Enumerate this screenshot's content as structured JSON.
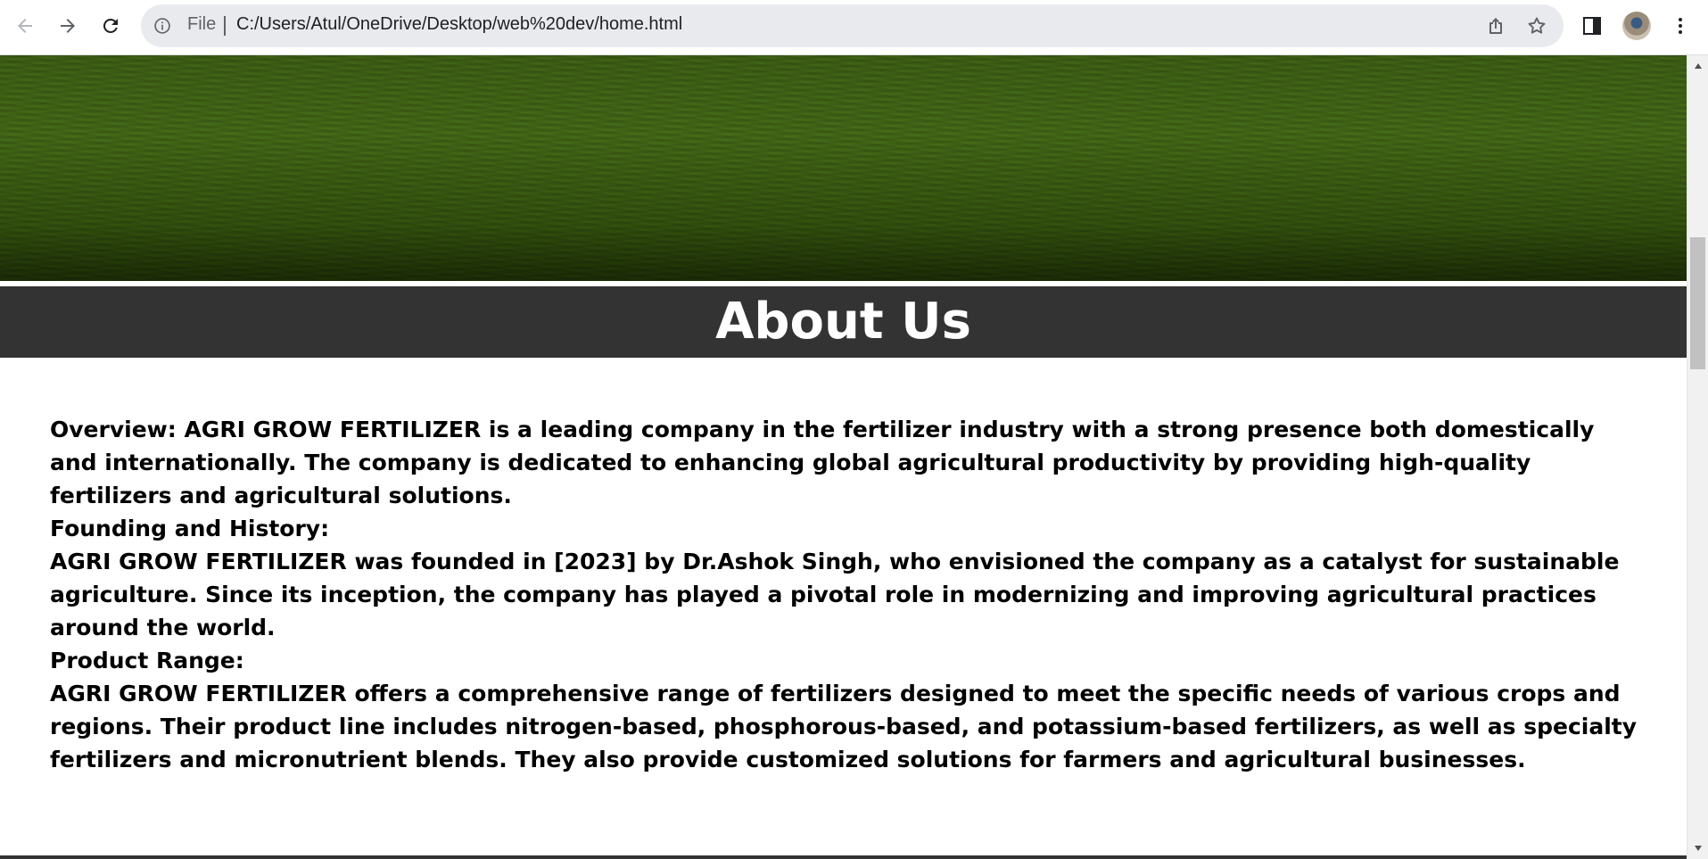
{
  "browser": {
    "back_icon": "arrow-left-icon",
    "forward_icon": "arrow-right-icon",
    "reload_icon": "reload-icon",
    "site_info_icon": "info-icon",
    "scheme_label": "File",
    "url": "C:/Users/Atul/OneDrive/Desktop/web%20dev/home.html",
    "share_icon": "share-icon",
    "bookmark_icon": "star-icon",
    "side_panel_icon": "side-panel-icon",
    "menu_icon": "kebab-menu-icon"
  },
  "page": {
    "about": {
      "title": "About Us",
      "paragraphs": [
        "Overview: AGRI GROW FERTILIZER is a leading company in the fertilizer industry with a strong presence both domestically and internationally. The company is dedicated to enhancing global agricultural productivity by providing high-quality fertilizers and agricultural solutions.",
        "Founding and History:",
        "AGRI GROW FERTILIZER was founded in [2023] by Dr.Ashok Singh, who envisioned the company as a catalyst for sustainable agriculture. Since its inception, the company has played a pivotal role in modernizing and improving agricultural practices around the world.",
        "Product Range:",
        "AGRI GROW FERTILIZER offers a comprehensive range of fertilizers designed to meet the specific needs of various crops and regions. Their product line includes nitrogen-based, phosphorous-based, and potassium-based fertilizers, as well as specialty fertilizers and micronutrient blends. They also provide customized solutions for farmers and agricultural businesses."
      ]
    }
  },
  "colors": {
    "about_band": "#333333",
    "hero_green": "#3c5a14",
    "text": "#000000"
  }
}
